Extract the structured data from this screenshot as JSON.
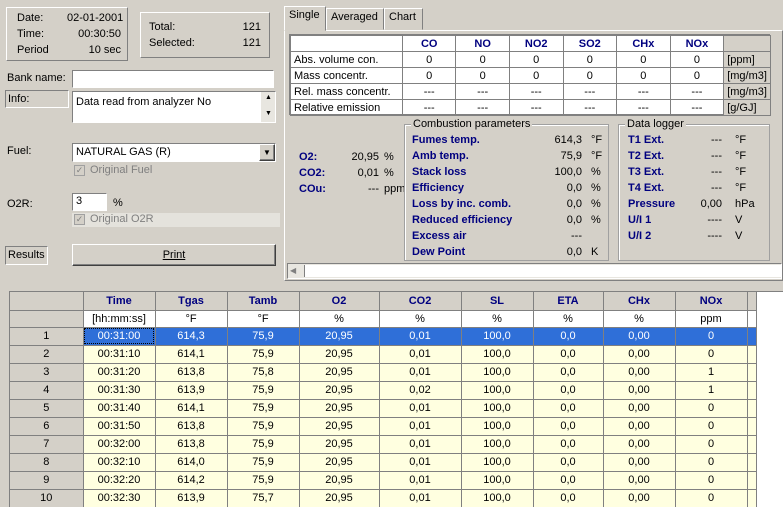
{
  "info": {
    "date_label": "Date:",
    "date_value": "02-01-2001",
    "time_label": "Time:",
    "time_value": "00:30:50",
    "period_label": "Period",
    "period_value": "10 sec",
    "total_label": "Total:",
    "total_value": "121",
    "selected_label": "Selected:",
    "selected_value": "121"
  },
  "form": {
    "bank_label": "Bank name:",
    "bank_value": "",
    "info_label": "Info:",
    "info_value": "Data read from analyzer No",
    "fuel_label": "Fuel:",
    "fuel_value": "NATURAL GAS (R)",
    "original_fuel_label": "Original Fuel",
    "o2r_label": "O2R:",
    "o2r_value": "3",
    "o2r_unit": "%",
    "original_o2r_label": "Original O2R",
    "results_label": "Results",
    "print_label": "Print"
  },
  "tabs": [
    "Single",
    "Averaged",
    "Chart"
  ],
  "emissions": {
    "columns": [
      "CO",
      "NO",
      "NO2",
      "SO2",
      "CHx",
      "NOx"
    ],
    "rows": [
      {
        "label": "Abs. volume con.",
        "values": [
          "0",
          "0",
          "0",
          "0",
          "0",
          "0"
        ],
        "unit": "[ppm]"
      },
      {
        "label": "Mass concentr.",
        "values": [
          "0",
          "0",
          "0",
          "0",
          "0",
          "0"
        ],
        "unit": "[mg/m3]"
      },
      {
        "label": "Rel. mass concentr.",
        "values": [
          "---",
          "---",
          "---",
          "---",
          "---",
          "---"
        ],
        "unit": "[mg/m3]"
      },
      {
        "label": "Relative emission",
        "values": [
          "---",
          "---",
          "---",
          "---",
          "---",
          "---"
        ],
        "unit": "[g/GJ]"
      }
    ]
  },
  "gases": [
    {
      "label": "O2:",
      "value": "20,95",
      "unit": "%"
    },
    {
      "label": "CO2:",
      "value": "0,01",
      "unit": "%"
    },
    {
      "label": "COu:",
      "value": "---",
      "unit": "ppm"
    }
  ],
  "combustion": {
    "title": "Combustion parameters",
    "rows": [
      {
        "label": "Fumes temp.",
        "value": "614,3",
        "unit": "°F"
      },
      {
        "label": "Amb temp.",
        "value": "75,9",
        "unit": "°F"
      },
      {
        "label": "Stack loss",
        "value": "100,0",
        "unit": "%"
      },
      {
        "label": "Efficiency",
        "value": "0,0",
        "unit": "%"
      },
      {
        "label": "Loss by inc. comb.",
        "value": "0,0",
        "unit": "%"
      },
      {
        "label": "Reduced efficiency",
        "value": "0,0",
        "unit": "%"
      },
      {
        "label": "Excess air",
        "value": "---",
        "unit": ""
      },
      {
        "label": "Dew Point",
        "value": "0,0",
        "unit": "K"
      }
    ]
  },
  "logger": {
    "title": "Data logger",
    "rows": [
      {
        "label": "T1 Ext.",
        "value": "---",
        "unit": "°F"
      },
      {
        "label": "T2 Ext.",
        "value": "---",
        "unit": "°F"
      },
      {
        "label": "T3 Ext.",
        "value": "---",
        "unit": "°F"
      },
      {
        "label": "T4 Ext.",
        "value": "---",
        "unit": "°F"
      },
      {
        "label": "Pressure",
        "value": "0,00",
        "unit": "hPa"
      },
      {
        "label": "U/I 1",
        "value": "----",
        "unit": "V"
      },
      {
        "label": "U/I 2",
        "value": "----",
        "unit": "V"
      }
    ]
  },
  "grid": {
    "headers": [
      "Time",
      "Tgas",
      "Tamb",
      "O2",
      "CO2",
      "SL",
      "ETA",
      "CHx",
      "NOx"
    ],
    "units": [
      "[hh:mm:ss]",
      "°F",
      "°F",
      "%",
      "%",
      "%",
      "%",
      "%",
      "ppm"
    ],
    "rows": [
      {
        "n": "1",
        "cells": [
          "00:31:00",
          "614,3",
          "75,9",
          "20,95",
          "0,01",
          "100,0",
          "0,0",
          "0,00",
          "0"
        ]
      },
      {
        "n": "2",
        "cells": [
          "00:31:10",
          "614,1",
          "75,9",
          "20,95",
          "0,01",
          "100,0",
          "0,0",
          "0,00",
          "0"
        ]
      },
      {
        "n": "3",
        "cells": [
          "00:31:20",
          "613,8",
          "75,8",
          "20,95",
          "0,01",
          "100,0",
          "0,0",
          "0,00",
          "1"
        ]
      },
      {
        "n": "4",
        "cells": [
          "00:31:30",
          "613,9",
          "75,9",
          "20,95",
          "0,02",
          "100,0",
          "0,0",
          "0,00",
          "1"
        ]
      },
      {
        "n": "5",
        "cells": [
          "00:31:40",
          "614,1",
          "75,9",
          "20,95",
          "0,01",
          "100,0",
          "0,0",
          "0,00",
          "0"
        ]
      },
      {
        "n": "6",
        "cells": [
          "00:31:50",
          "613,8",
          "75,9",
          "20,95",
          "0,01",
          "100,0",
          "0,0",
          "0,00",
          "0"
        ]
      },
      {
        "n": "7",
        "cells": [
          "00:32:00",
          "613,8",
          "75,9",
          "20,95",
          "0,01",
          "100,0",
          "0,0",
          "0,00",
          "0"
        ]
      },
      {
        "n": "8",
        "cells": [
          "00:32:10",
          "614,0",
          "75,9",
          "20,95",
          "0,01",
          "100,0",
          "0,0",
          "0,00",
          "0"
        ]
      },
      {
        "n": "9",
        "cells": [
          "00:32:20",
          "614,2",
          "75,9",
          "20,95",
          "0,01",
          "100,0",
          "0,0",
          "0,00",
          "0"
        ]
      },
      {
        "n": "10",
        "cells": [
          "00:32:30",
          "613,9",
          "75,7",
          "20,95",
          "0,01",
          "100,0",
          "0,0",
          "0,00",
          "0"
        ]
      }
    ]
  }
}
